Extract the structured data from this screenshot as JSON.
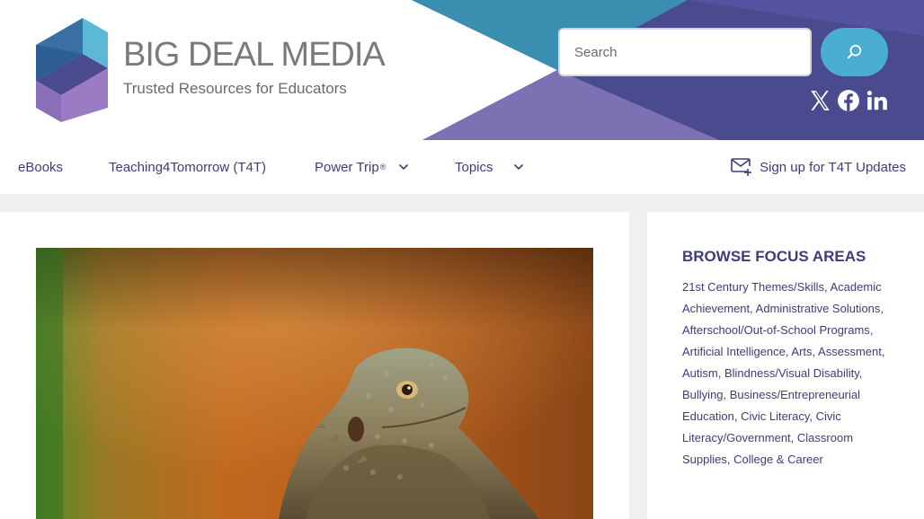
{
  "brand": {
    "title": "BIG DEAL MEDIA",
    "tagline": "Trusted Resources for Educators"
  },
  "search": {
    "placeholder": "Search",
    "value": "",
    "button_icon": "search-icon"
  },
  "social": [
    {
      "name": "x",
      "icon": "x-icon"
    },
    {
      "name": "facebook",
      "icon": "facebook-icon"
    },
    {
      "name": "linkedin",
      "icon": "linkedin-icon"
    }
  ],
  "nav": {
    "items": [
      {
        "label": "eBooks"
      },
      {
        "label": "Teaching4Tomorrow (T4T)"
      },
      {
        "label": "Power Trip",
        "sup": "®",
        "dropdown": true
      },
      {
        "label": "Topics",
        "dropdown": true
      }
    ],
    "signup": "Sign up for T4T Updates"
  },
  "sidebar": {
    "title": "BROWSE FOCUS AREAS",
    "items": [
      "21st Century Themes/Skills",
      "Academic Achievement",
      "Administrative Solutions",
      "Afterschool/Out-of-School Programs",
      "Artificial Intelligence",
      "Arts",
      "Assessment",
      "Autism",
      "Blindness/Visual Disability",
      "Bullying",
      "Business/Entrepreneurial Education",
      "Civic Literacy",
      "Civic Literacy/Government",
      "Classroom Supplies",
      "College & Career"
    ]
  },
  "colors": {
    "brand_navy": "#3d3d7a",
    "accent_blue": "#4aaed4",
    "banner_purple": "#4a4a8e",
    "banner_teal": "#3a8eb0",
    "banner_lavender": "#7d71b3"
  }
}
